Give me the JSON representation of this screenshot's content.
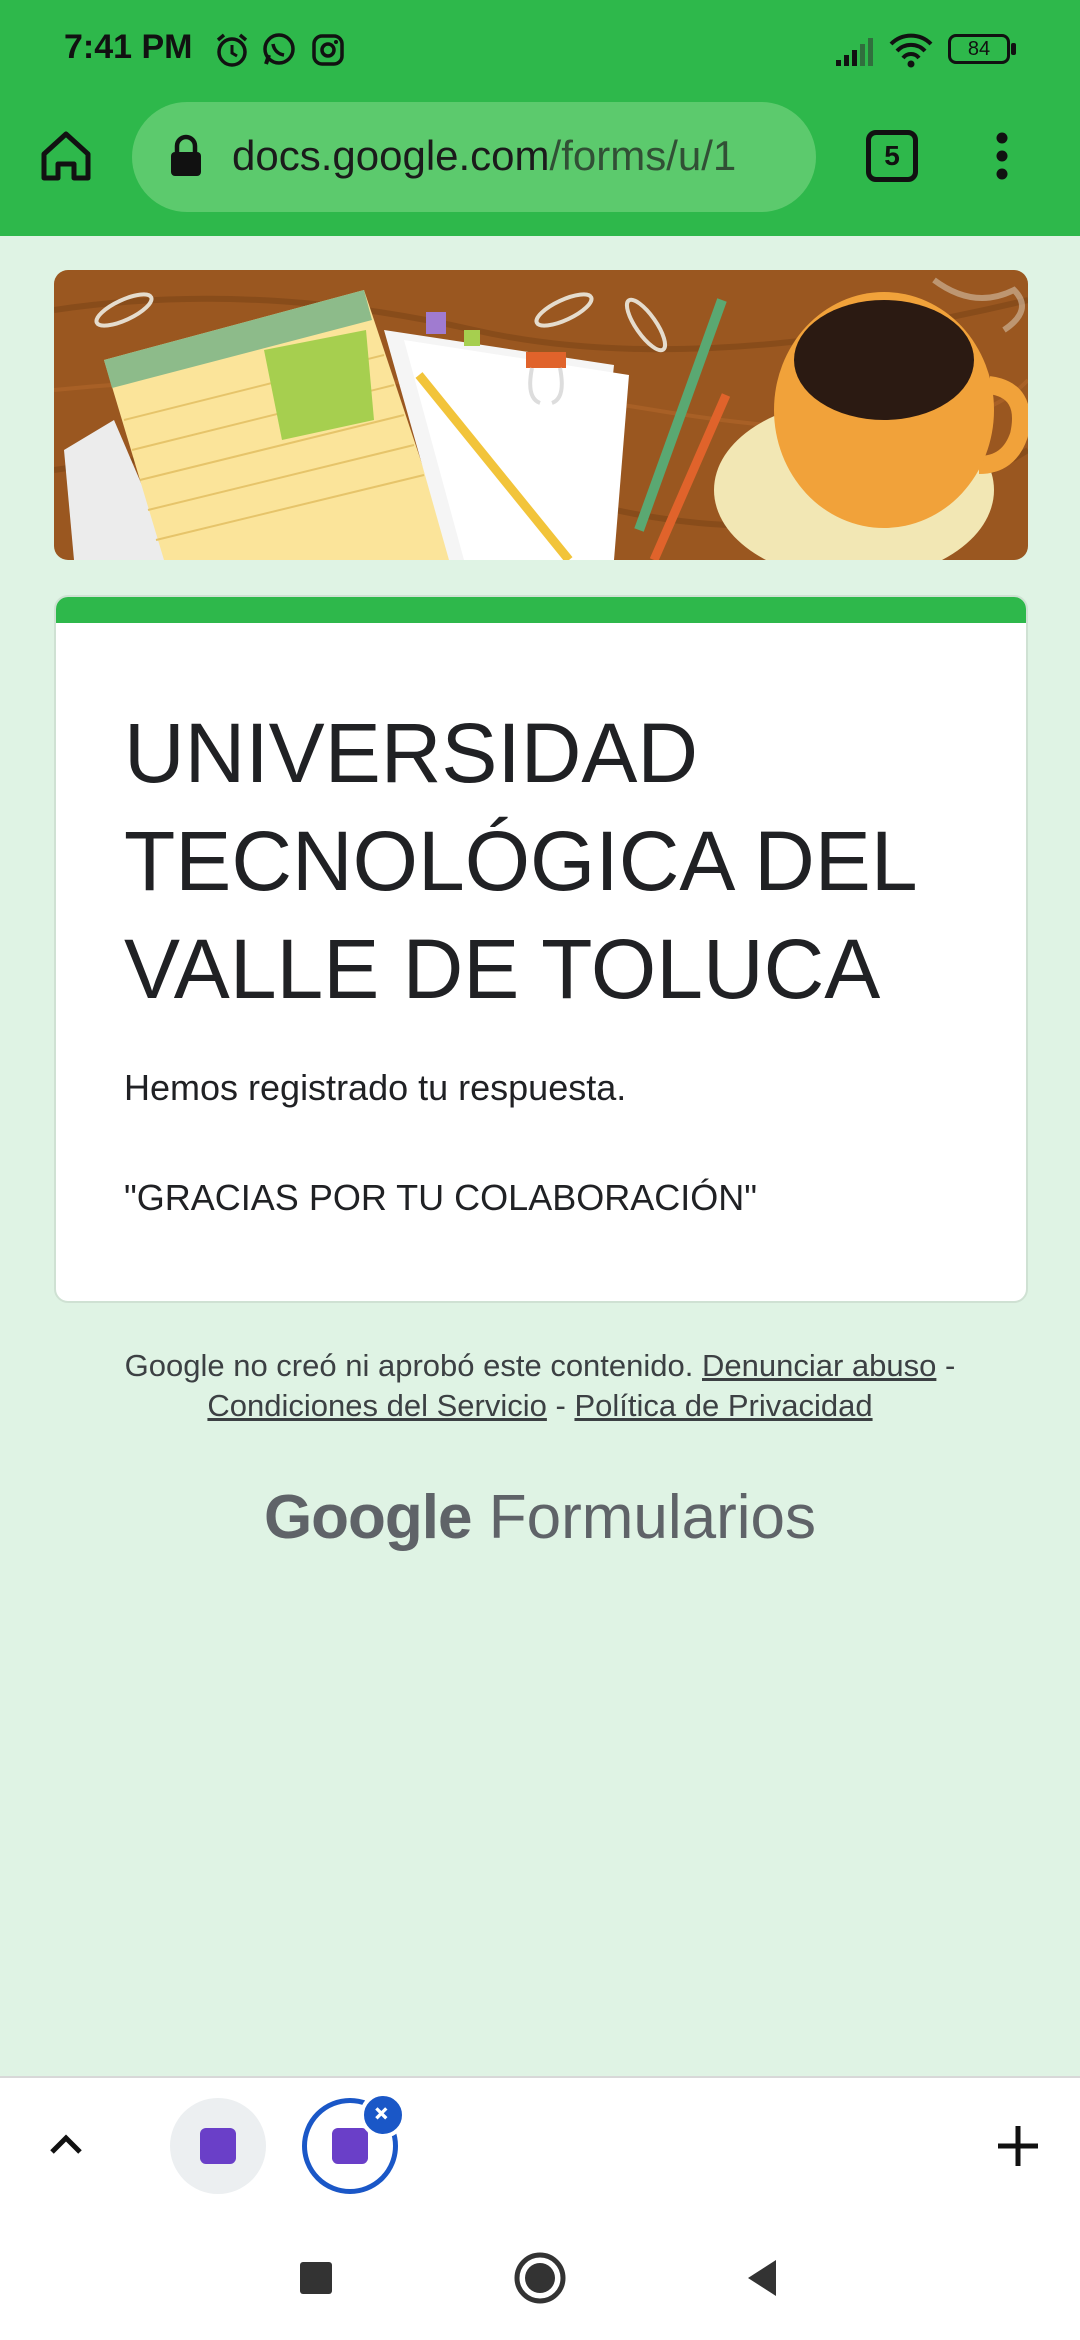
{
  "status_bar": {
    "time": "7:41 PM",
    "battery": "84",
    "icons": [
      "alarm-icon",
      "whatsapp-icon",
      "instagram-icon",
      "signal-icon",
      "wifi-icon"
    ]
  },
  "browser": {
    "url_host": "docs.google.com",
    "url_path": "/forms/u/1",
    "tab_count": "5"
  },
  "form": {
    "title": "UNIVERSIDAD TECNOLÓGICA DEL VALLE DE TOLUCA",
    "message": "Hemos registrado tu respuesta.",
    "thanks": "\"GRACIAS POR TU COLABORACIÓN\""
  },
  "footer": {
    "disclaimer": "Google no creó ni aprobó este contenido.",
    "report_abuse": "Denunciar abuso",
    "terms": "Condiciones del Servicio",
    "privacy": "Política de Privacidad",
    "separator": "-"
  },
  "brand": {
    "google": "Google",
    "product": "Formularios"
  },
  "colors": {
    "accent": "#2eb84b",
    "background": "#dff3e4",
    "tab_active": "#1a57c7",
    "form_icon": "#6a3fc8"
  }
}
